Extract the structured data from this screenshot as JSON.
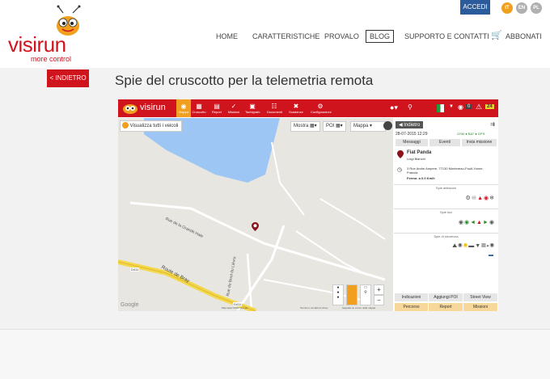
{
  "header": {
    "brand": "visirun",
    "tagline": "more control",
    "nav": [
      "HOME",
      "CARATTERISTICHE",
      "PROVALO",
      "BLOG",
      "SUPPORTO E CONTATTI",
      "ABBONATI"
    ],
    "login": "ACCEDI",
    "languages": [
      "IT",
      "EN",
      "PL"
    ]
  },
  "page": {
    "back": "< INDIETRO",
    "title": "Spie del cruscotto per la telemetria remota"
  },
  "app": {
    "brand": "visirun",
    "toolbar": [
      "Mappa",
      "Cruscotto",
      "Report",
      "Missioni",
      "Tachigrafo",
      "Documenti",
      "Scadenze",
      "Configurazioni"
    ],
    "badge_count": "24",
    "chat_count": "0",
    "map_controls": {
      "show_all": "Visualizza tutti i veicoli",
      "show": "Mostra",
      "poi": "POI",
      "map_type": "Mappa"
    },
    "map_labels": [
      "Rue de la Grande Haie",
      "Rue du Bout du Lièvre",
      "Route de Bray",
      "D411",
      "D411",
      "Google",
      "Map data ©2015 Google",
      "Termini e condizioni d'uso",
      "Segnala un errore nella mappa"
    ],
    "panel": {
      "back": "Indietro",
      "datetime": "28-07-2015 12:29",
      "status_icons": "GSM ● BAT ● GPS",
      "tabs": [
        "Messaggi",
        "Eventi",
        "Invia missione"
      ],
      "vehicle": "Fiat Panda",
      "driver": "Luigi Bianchi",
      "address": "3 Rue Andre Ampere, 77130 Montereau-Fault-Yonne, Francia",
      "status": "Fermo: a 0.0 Km/h",
      "sections": [
        "Spie abitacolo",
        "Spie luci",
        "Spie di sicurezza"
      ],
      "buttons_row1": [
        "Indicazioni",
        "Aggiungi POI",
        "Street View"
      ],
      "buttons_row2": [
        "Percorso",
        "Report",
        "Missioni"
      ]
    }
  },
  "colors": {
    "brand_red": "#d0141e",
    "accedi_blue": "#2b5b9b",
    "lang_active": "#f0a01e",
    "lang_inactive": "#b0b0b0",
    "water": "#9ec6f4",
    "road_yellow": "#f4d84b"
  }
}
